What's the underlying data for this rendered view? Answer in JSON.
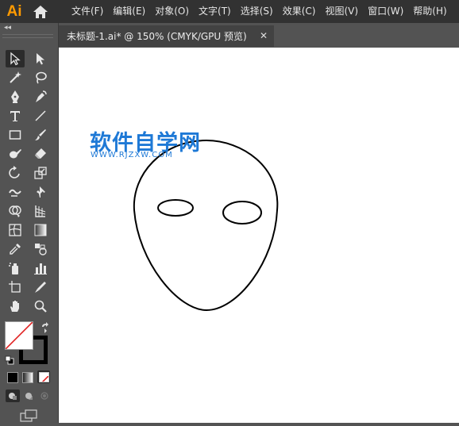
{
  "app": {
    "logo": "Ai"
  },
  "menu": [
    {
      "label": "文件(F)"
    },
    {
      "label": "编辑(E)"
    },
    {
      "label": "对象(O)"
    },
    {
      "label": "文字(T)"
    },
    {
      "label": "选择(S)"
    },
    {
      "label": "效果(C)"
    },
    {
      "label": "视图(V)"
    },
    {
      "label": "窗口(W)"
    },
    {
      "label": "帮助(H)"
    }
  ],
  "document_tab": {
    "title": "未标题-1.ai* @ 150% (CMYK/GPU 预览)",
    "close_glyph": "✕"
  },
  "toolbar": {
    "collapse_glyph": "◂◂",
    "tools": [
      {
        "name": "selection-tool-icon"
      },
      {
        "name": "direct-selection-tool-icon"
      },
      {
        "name": "magic-wand-tool-icon"
      },
      {
        "name": "lasso-tool-icon"
      },
      {
        "name": "pen-tool-icon"
      },
      {
        "name": "curvature-tool-icon"
      },
      {
        "name": "type-tool-icon"
      },
      {
        "name": "line-segment-tool-icon"
      },
      {
        "name": "rectangle-tool-icon"
      },
      {
        "name": "paintbrush-tool-icon"
      },
      {
        "name": "blob-brush-tool-icon"
      },
      {
        "name": "eraser-tool-icon"
      },
      {
        "name": "rotate-tool-icon"
      },
      {
        "name": "scale-tool-icon"
      },
      {
        "name": "warp-tool-icon"
      },
      {
        "name": "puppet-warp-tool-icon"
      },
      {
        "name": "shape-builder-tool-icon"
      },
      {
        "name": "perspective-grid-tool-icon"
      },
      {
        "name": "mesh-tool-icon"
      },
      {
        "name": "gradient-tool-icon"
      },
      {
        "name": "eyedropper-tool-icon"
      },
      {
        "name": "blend-tool-icon"
      },
      {
        "name": "symbol-sprayer-tool-icon"
      },
      {
        "name": "column-graph-tool-icon"
      },
      {
        "name": "artboard-tool-icon"
      },
      {
        "name": "slice-tool-icon"
      },
      {
        "name": "hand-tool-icon"
      },
      {
        "name": "zoom-tool-icon"
      }
    ]
  },
  "watermark": {
    "title": "软件自学网",
    "url": "WWW.RJZXW.COM"
  },
  "colors": {
    "menubar_bg": "#323232",
    "panel_bg": "#535353",
    "logo": "#ff9a00",
    "watermark": "#1e79d6",
    "canvas": "#ffffff"
  }
}
